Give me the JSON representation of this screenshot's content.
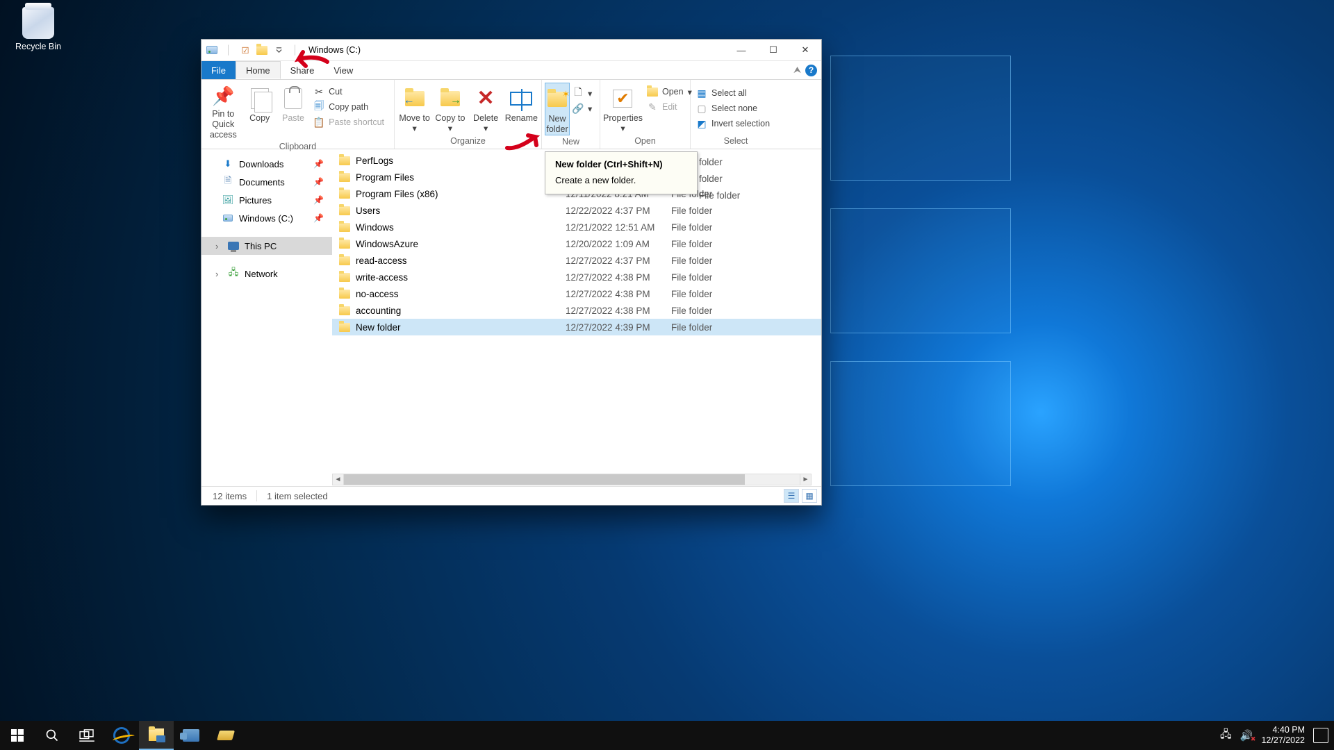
{
  "desktop": {
    "recycle_bin": "Recycle Bin"
  },
  "window": {
    "title": "Windows (C:)",
    "tabs": {
      "file": "File",
      "home": "Home",
      "share": "Share",
      "view": "View"
    }
  },
  "ribbon": {
    "clipboard": {
      "label": "Clipboard",
      "pin": "Pin to Quick access",
      "copy": "Copy",
      "paste": "Paste",
      "cut": "Cut",
      "copy_path": "Copy path",
      "paste_shortcut": "Paste shortcut"
    },
    "organize": {
      "label": "Organize",
      "move_to": "Move to",
      "copy_to": "Copy to",
      "delete": "Delete",
      "rename": "Rename"
    },
    "new": {
      "label": "New",
      "new_folder": "New folder"
    },
    "open": {
      "label": "Open",
      "properties": "Properties",
      "open": "Open",
      "edit": "Edit"
    },
    "select": {
      "label": "Select",
      "select_all": "Select all",
      "select_none": "Select none",
      "invert": "Invert selection"
    }
  },
  "tooltip": {
    "title": "New folder (Ctrl+Shift+N)",
    "body": "Create a new folder."
  },
  "nav": {
    "downloads": "Downloads",
    "documents": "Documents",
    "pictures": "Pictures",
    "windows_c": "Windows (C:)",
    "this_pc": "This PC",
    "network": "Network"
  },
  "files": [
    {
      "name": "PerfLogs",
      "date": "",
      "type": "folder"
    },
    {
      "name": "Program Files",
      "date": "",
      "type": "folder"
    },
    {
      "name": "Program Files (x86)",
      "date": "12/11/2022 8:21 AM",
      "type": "File folder"
    },
    {
      "name": "Users",
      "date": "12/22/2022 4:37 PM",
      "type": "File folder"
    },
    {
      "name": "Windows",
      "date": "12/21/2022 12:51 AM",
      "type": "File folder"
    },
    {
      "name": "WindowsAzure",
      "date": "12/20/2022 1:09 AM",
      "type": "File folder"
    },
    {
      "name": "read-access",
      "date": "12/27/2022 4:37 PM",
      "type": "File folder"
    },
    {
      "name": "write-access",
      "date": "12/27/2022 4:38 PM",
      "type": "File folder"
    },
    {
      "name": "no-access",
      "date": "12/27/2022 4:38 PM",
      "type": "File folder"
    },
    {
      "name": "accounting",
      "date": "12/27/2022 4:38 PM",
      "type": "File folder"
    },
    {
      "name": "New folder",
      "date": "12/27/2022 4:39 PM",
      "type": "File folder",
      "selected": true
    }
  ],
  "tooltip_overlay_types": {
    "first": "folder",
    "second": "folder",
    "third": "File folder"
  },
  "status": {
    "count": "12 items",
    "selected": "1 item selected"
  },
  "tray": {
    "time": "4:40 PM",
    "date": "12/27/2022"
  }
}
